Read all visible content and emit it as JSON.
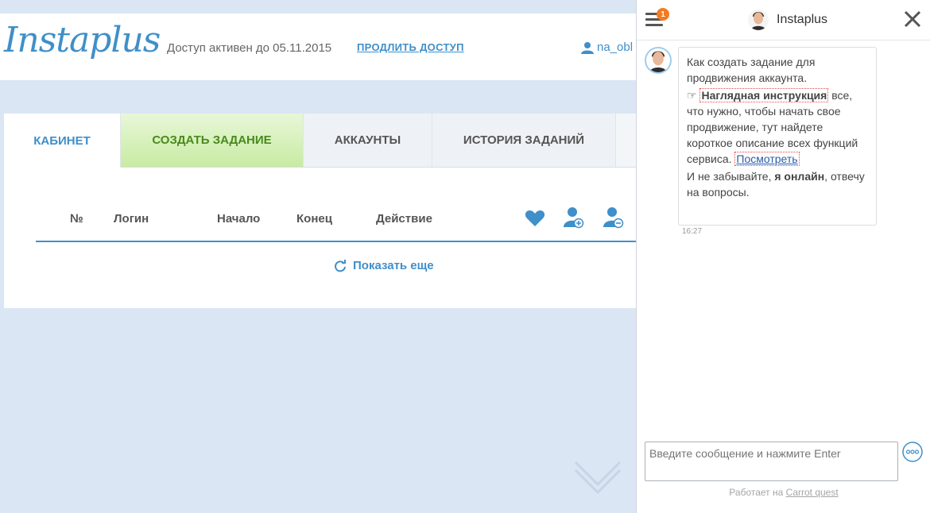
{
  "header": {
    "logo": "Instaplus",
    "access_text": "Доступ активен до 05.11.2015",
    "extend_link": "ПРОДЛИТЬ ДОСТУП",
    "username": "na_obl"
  },
  "tabs": [
    {
      "label": "КАБИНЕТ"
    },
    {
      "label": "СОЗДАТЬ ЗАДАНИЕ"
    },
    {
      "label": "АККАУНТЫ"
    },
    {
      "label": "ИСТОРИЯ ЗАДАНИЙ"
    }
  ],
  "table": {
    "columns": [
      "№",
      "Логин",
      "Начало",
      "Конец",
      "Действие"
    ],
    "icon_columns": [
      "heart-icon",
      "add-user-icon",
      "remove-user-icon"
    ],
    "show_more": "Показать еще"
  },
  "chat": {
    "badge_count": "1",
    "title": "Instaplus",
    "message": {
      "line1": "Как создать задание для продвижения аккаунта.",
      "highlight": "Наглядная инструкция",
      "line2": "все, что нужно, чтобы начать свое продвижение, тут найдете короткое описание всех функций сервиса.",
      "link": "Посмотреть",
      "line3_pre": "И не забывайте,",
      "line3_bold": "я онлайн",
      "line3_post": ", отвечу на вопросы.",
      "time": "16:27"
    },
    "input_placeholder": "Введите сообщение и нажмите Enter",
    "powered_prefix": "Работает на",
    "powered_link": "Carrot quest"
  },
  "colors": {
    "accent": "#3f8fc9",
    "background": "#dae6f3",
    "create_tab": "#c8eba3",
    "badge": "#f47b20"
  }
}
